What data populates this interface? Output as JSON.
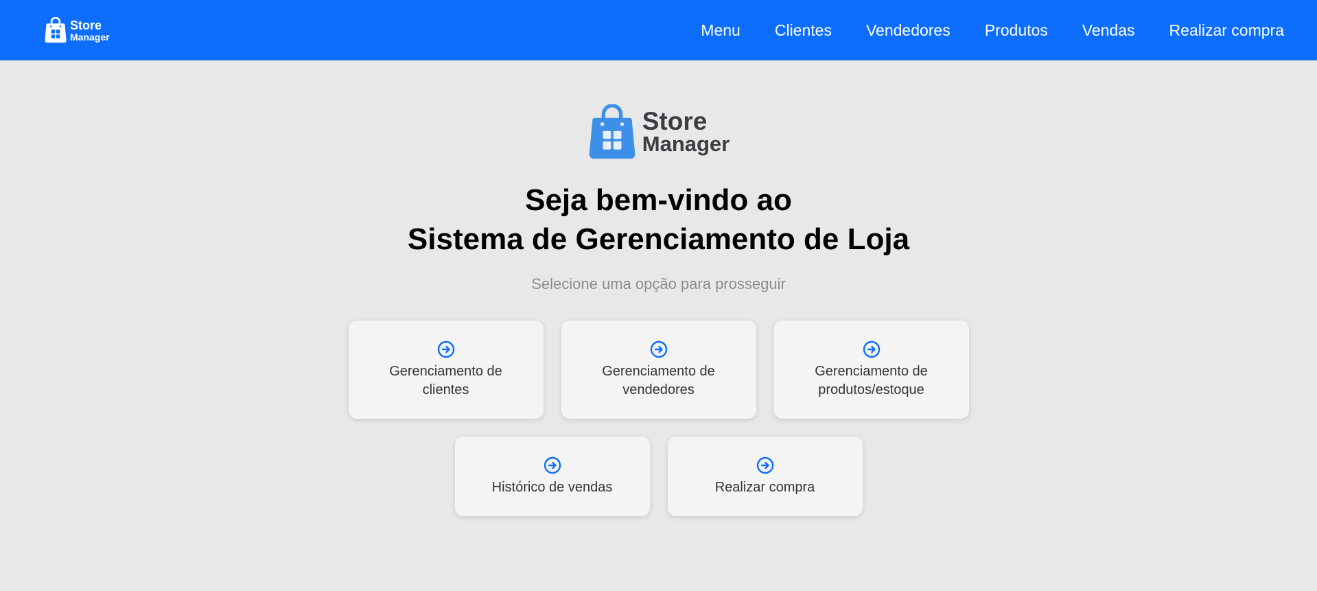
{
  "navbar": {
    "brand": {
      "line1": "Store",
      "line2": "Manager"
    },
    "links": [
      "Menu",
      "Clientes",
      "Vendedores",
      "Produtos",
      "Vendas",
      "Realizar compra"
    ]
  },
  "hero": {
    "logo": {
      "line1": "Store",
      "line2": "Manager"
    },
    "title_line1": "Seja bem-vindo ao",
    "title_line2": "Sistema de Gerenciamento de Loja",
    "subtitle": "Selecione uma opção para prosseguir"
  },
  "cards": [
    {
      "label": "Gerenciamento de clientes",
      "icon": "arrow-circle-right-icon"
    },
    {
      "label": "Gerenciamento de vendedores",
      "icon": "arrow-circle-right-icon"
    },
    {
      "label": "Gerenciamento de produtos/estoque",
      "icon": "arrow-circle-right-icon"
    },
    {
      "label": "Histórico de vendas",
      "icon": "arrow-circle-right-icon"
    },
    {
      "label": "Realizar compra",
      "icon": "arrow-circle-right-icon"
    }
  ],
  "colors": {
    "primary": "#0d6efd",
    "logo_blue": "#3d8fe8",
    "logo_text": "#3a3d42",
    "background": "#e8e8e8",
    "card_background": "#f4f4f4"
  }
}
